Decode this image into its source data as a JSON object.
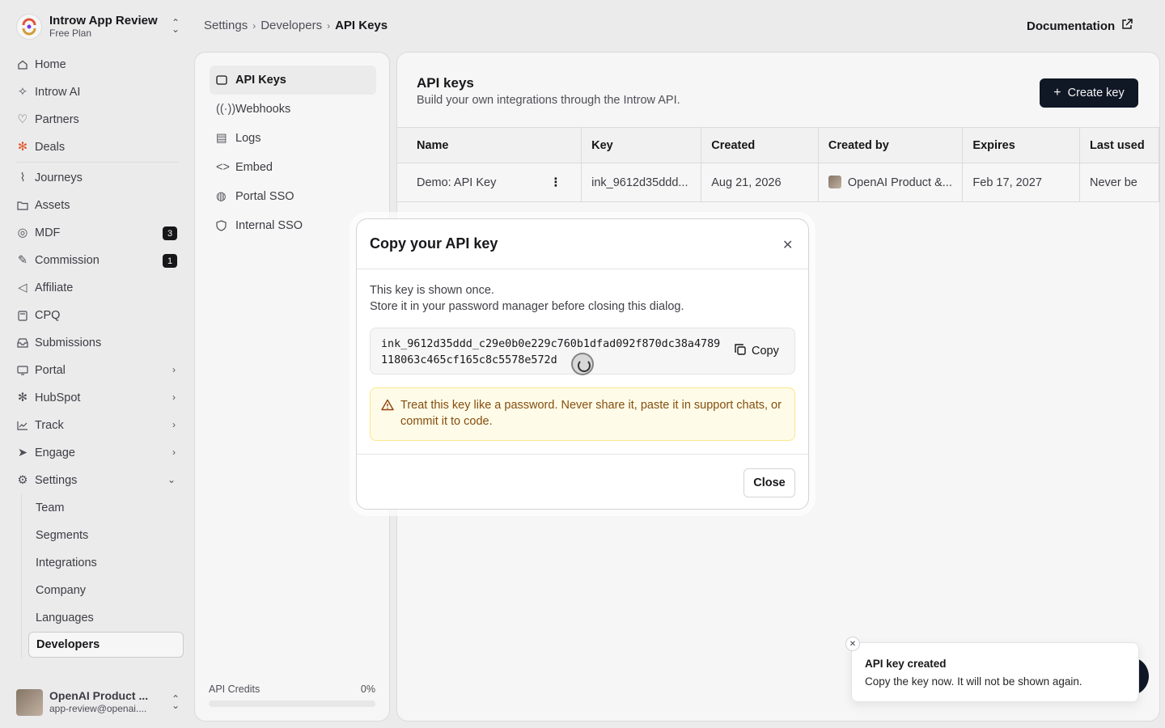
{
  "org": {
    "name": "Introw App Review",
    "plan": "Free Plan"
  },
  "sidebar": {
    "items": [
      {
        "label": "Home",
        "icon": "home-icon"
      },
      {
        "label": "Introw AI",
        "icon": "sparkle-icon"
      },
      {
        "label": "Partners",
        "icon": "handshake-icon"
      },
      {
        "label": "Deals",
        "icon": "hubspot-icon"
      },
      {
        "label": "Journeys",
        "icon": "route-icon"
      },
      {
        "label": "Assets",
        "icon": "folder-icon"
      },
      {
        "label": "MDF",
        "icon": "coins-icon",
        "badge": "3"
      },
      {
        "label": "Commission",
        "icon": "percent-icon",
        "badge": "1"
      },
      {
        "label": "Affiliate",
        "icon": "megaphone-icon"
      },
      {
        "label": "CPQ",
        "icon": "calculator-icon"
      },
      {
        "label": "Submissions",
        "icon": "inbox-icon"
      },
      {
        "label": "Portal",
        "icon": "monitor-icon"
      },
      {
        "label": "HubSpot",
        "icon": "hubspot-icon"
      },
      {
        "label": "Track",
        "icon": "chart-icon"
      },
      {
        "label": "Engage",
        "icon": "send-icon"
      },
      {
        "label": "Settings",
        "icon": "gear-icon"
      }
    ],
    "settings_sub": [
      "Team",
      "Segments",
      "Integrations",
      "Company",
      "Languages",
      "Developers"
    ]
  },
  "user": {
    "name": "OpenAI Product ...",
    "email": "app-review@openai...."
  },
  "breadcrumb": {
    "level1": "Settings",
    "level2": "Developers",
    "current": "API Keys"
  },
  "docs_link": "Documentation",
  "dev_nav": [
    "API Keys",
    "Webhooks",
    "Logs",
    "Embed",
    "Portal SSO",
    "Internal SSO"
  ],
  "credits": {
    "label": "API Credits",
    "value": "0%",
    "fraction": 0
  },
  "main": {
    "title": "API keys",
    "subtitle": "Build your own integrations through the Introw API.",
    "create_label": "Create key",
    "columns": [
      "Name",
      "Key",
      "Created",
      "Created by",
      "Expires",
      "Last used"
    ],
    "rows": [
      {
        "name": "Demo: API Key",
        "key": "ink_9612d35ddd...",
        "created": "Aug 21, 2026",
        "created_by": "OpenAI Product &...",
        "expires": "Feb 17, 2027",
        "last_used": "Never be"
      }
    ]
  },
  "modal": {
    "title": "Copy your API key",
    "desc_line1": "This key is shown once.",
    "desc_line2": "Store it in your password manager before closing this dialog.",
    "key": "ink_9612d35ddd_c29e0b0e229c760b1dfad092f870dc38a4789118063c465cf165c8c5578e572d",
    "copy_label": "Copy",
    "warning": "Treat this key like a password. Never share it, paste it in support chats, or commit it to code.",
    "close_label": "Close"
  },
  "toast": {
    "title": "API key created",
    "desc": "Copy the key now. It will not be shown again."
  }
}
